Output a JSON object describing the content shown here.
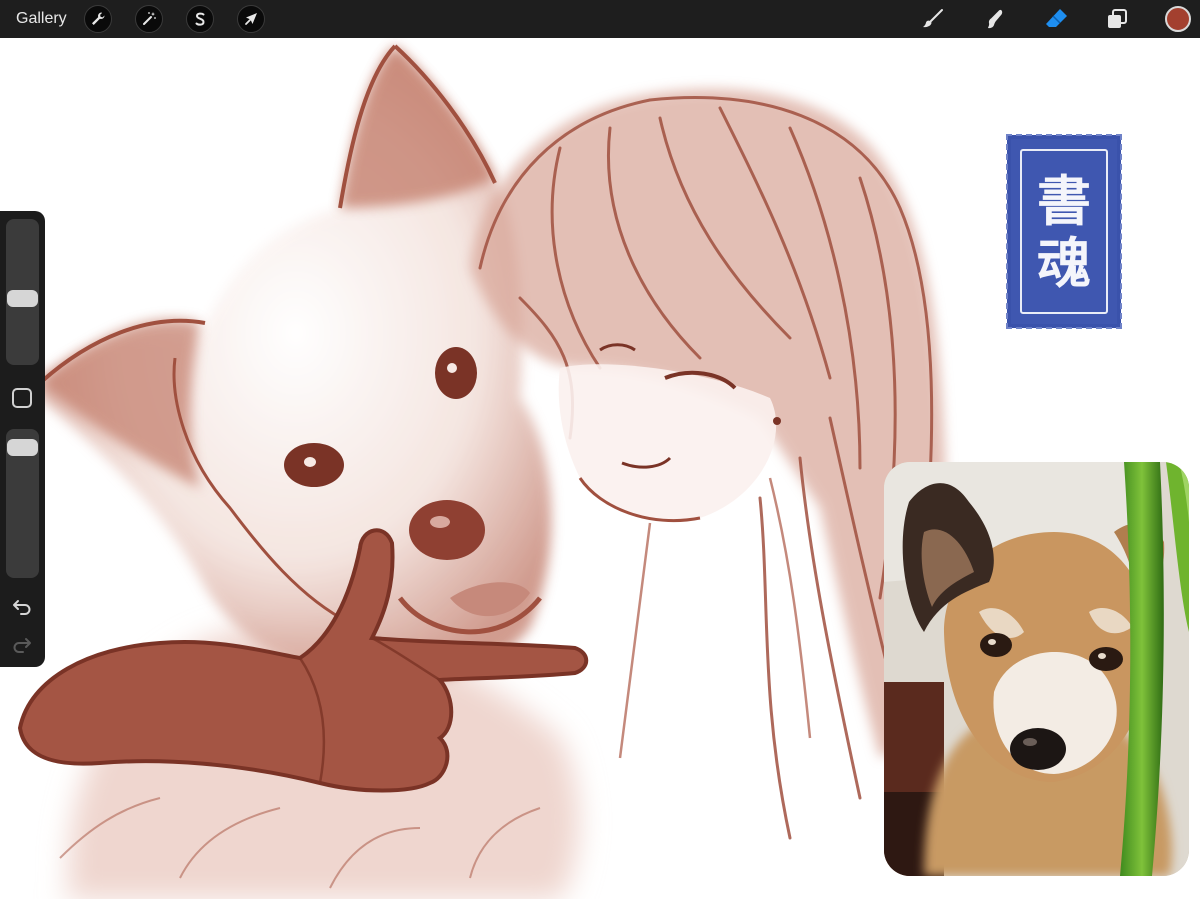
{
  "toolbar": {
    "gallery_label": "Gallery",
    "left_tools": [
      {
        "name": "actions",
        "icon": "wrench-icon"
      },
      {
        "name": "adjustments",
        "icon": "magic-wand-icon"
      },
      {
        "name": "selection",
        "icon": "selection-s-icon"
      },
      {
        "name": "transform",
        "icon": "arrow-cursor-icon"
      }
    ],
    "right_tools": [
      {
        "name": "brush",
        "icon": "brush-icon"
      },
      {
        "name": "smudge",
        "icon": "smudge-finger-icon"
      },
      {
        "name": "eraser",
        "icon": "eraser-icon",
        "active": true
      },
      {
        "name": "layers",
        "icon": "layers-icon"
      }
    ],
    "active_color": "#a3402f",
    "active_tool_color": "#1e8ef0"
  },
  "sidebar": {
    "brush_size_level": 0.45,
    "opacity_level": 0.95,
    "modify_icon": "square-icon",
    "undo_icon": "undo-arrow-icon",
    "redo_icon": "redo-arrow-icon"
  },
  "seal": {
    "char1": "書",
    "char2": "魂",
    "color": "#3f57b0"
  },
  "canvas": {
    "ink_color": "#a0503f"
  }
}
